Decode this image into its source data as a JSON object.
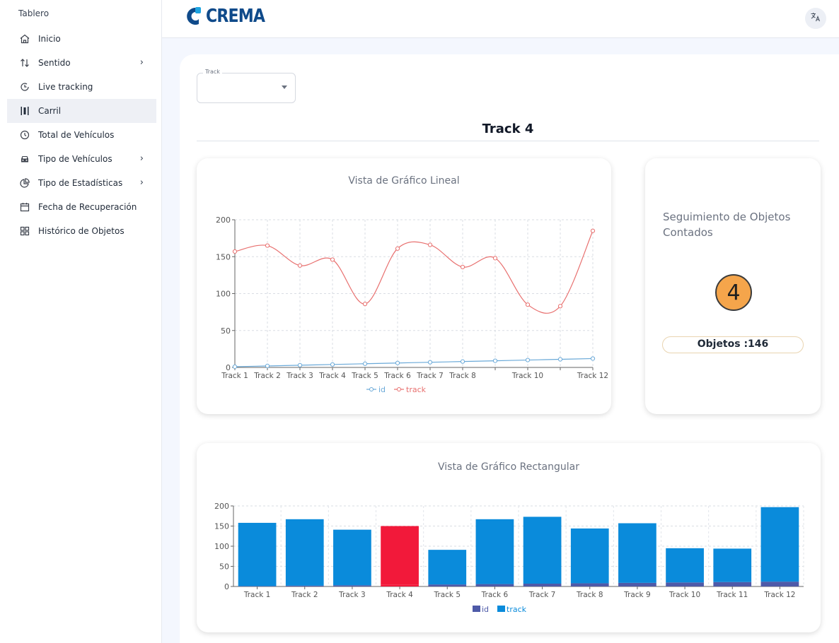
{
  "sidebar": {
    "title": "Tablero",
    "items": [
      {
        "label": "Inicio",
        "icon": "home-icon"
      },
      {
        "label": "Sentido",
        "icon": "swap-vertical-icon",
        "chevron": true
      },
      {
        "label": "Live tracking",
        "icon": "clock-live-icon"
      },
      {
        "label": "Carril",
        "icon": "lane-icon",
        "active": true
      },
      {
        "label": "Total de Vehículos",
        "icon": "clock-icon"
      },
      {
        "label": "Tipo de Vehículos",
        "icon": "car-icon",
        "chevron": true
      },
      {
        "label": "Tipo de Estadísticas",
        "icon": "pie-chart-icon",
        "chevron": true
      },
      {
        "label": "Fecha de Recuperación",
        "icon": "calendar-icon"
      },
      {
        "label": "Histórico de Objetos",
        "icon": "grid-icon"
      }
    ]
  },
  "header": {
    "logo_text": "CREMA",
    "lang_icon": "translate-icon",
    "brand_color": "#0f4a8a"
  },
  "filter": {
    "label": "Track",
    "value": ""
  },
  "section_title": "Track 4",
  "line_card": {
    "title": "Vista de Gráfico Lineal"
  },
  "count_card": {
    "title": "Seguimiento de Objetos Contados",
    "count": "4",
    "objects_text": "Objetos :146"
  },
  "bar_card": {
    "title": "Vista de Gráfico Rectangular"
  },
  "chart_data": [
    {
      "type": "line",
      "title": "Vista de Gráfico Lineal",
      "categories": [
        "Track 1",
        "Track 2",
        "Track 3",
        "Track 4",
        "Track 5",
        "Track 6",
        "Track 7",
        "Track 8",
        "Track 9",
        "Track 10",
        "Track 11",
        "Track 12"
      ],
      "tick_labels": [
        "Track 1",
        "Track 2",
        "Track 3",
        "Track 4",
        "Track 5",
        "Track 6",
        "Track 7",
        "Track 8",
        "",
        "Track 10",
        "",
        "Track 12"
      ],
      "ylim": [
        0,
        200
      ],
      "yticks": [
        0,
        50,
        100,
        150,
        200
      ],
      "grid": true,
      "legend": "bottom",
      "series": [
        {
          "name": "id",
          "color": "#6aa9d8",
          "values": [
            1,
            2,
            3,
            4,
            5,
            6,
            7,
            8,
            9,
            10,
            11,
            12
          ]
        },
        {
          "name": "track",
          "color": "#e8706f",
          "values": [
            157,
            165,
            138,
            146,
            86,
            161,
            166,
            136,
            148,
            85,
            83,
            185
          ]
        }
      ]
    },
    {
      "type": "bar",
      "title": "Vista de Gráfico Rectangular",
      "categories": [
        "Track 1",
        "Track 2",
        "Track 3",
        "Track 4",
        "Track 5",
        "Track 6",
        "Track 7",
        "Track 8",
        "Track 9",
        "Track 10",
        "Track 11",
        "Track 12"
      ],
      "ylim": [
        0,
        200
      ],
      "yticks": [
        0,
        50,
        100,
        150,
        200
      ],
      "grid": true,
      "legend": "bottom",
      "stacked": true,
      "highlight": {
        "category": "Track 4",
        "color": "#f2193a"
      },
      "series": [
        {
          "name": "id",
          "color": "#4e5aa8",
          "values": [
            1,
            2,
            3,
            4,
            5,
            6,
            7,
            8,
            9,
            10,
            11,
            12
          ]
        },
        {
          "name": "track",
          "color": "#0a8bdb",
          "values": [
            157,
            165,
            138,
            146,
            86,
            161,
            166,
            136,
            148,
            85,
            83,
            185
          ]
        }
      ]
    }
  ]
}
